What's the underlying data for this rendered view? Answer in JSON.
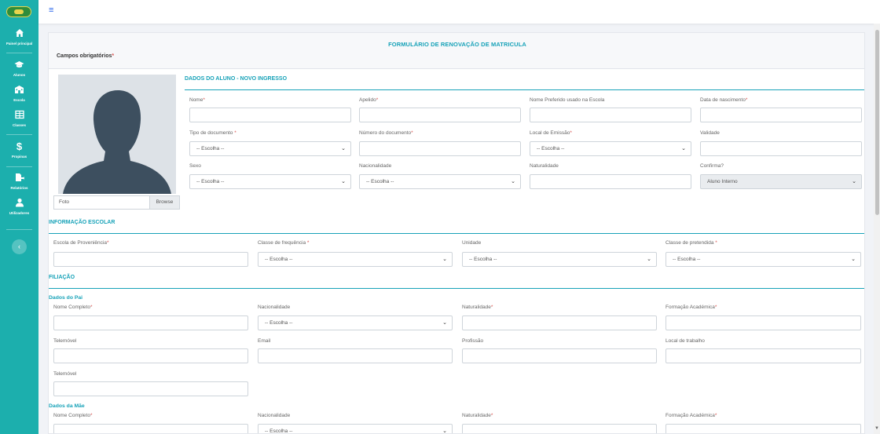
{
  "sidebar": {
    "items": [
      {
        "label": "Painel principal",
        "icon": "home-icon"
      },
      {
        "label": "Alunos",
        "icon": "graduation-cap-icon"
      },
      {
        "label": "Escola",
        "icon": "school-icon"
      },
      {
        "label": "Classes",
        "icon": "table-icon"
      },
      {
        "label": "Propinas",
        "icon": "dollar-icon"
      },
      {
        "label": "Relatórios",
        "icon": "report-icon"
      },
      {
        "label": "Utilizadores",
        "icon": "user-icon"
      }
    ],
    "collapse_glyph": "‹"
  },
  "topbar": {
    "menu_glyph": "≡"
  },
  "form": {
    "title": "FORMULÁRIO DE RENOVAÇÃO DE MATRICULA",
    "required_note": "Campos obrigatórios",
    "photo": {
      "placeholder": "Foto",
      "browse": "Browse"
    },
    "student": {
      "title": "DADOS DO ALUNO - NOVO INGRESSO",
      "nome": "Nome",
      "apelido": "Apelido",
      "nome_preferido": "Nome Preferido usado na Escola",
      "data_nascimento": "Data de nascimento",
      "tipo_documento": "Tipo de documento",
      "tipo_documento_value": "-- Escolha --",
      "numero_documento": "Número do documento",
      "local_emissao": "Local de Emissão",
      "local_emissao_value": "-- Escolha --",
      "validade": "Validade",
      "sexo": "Sexo",
      "sexo_value": "-- Escolha --",
      "nacionalidade": "Nacionalidade",
      "nacionalidade_value": "-- Escolha --",
      "naturalidade": "Naturalidade",
      "confirma": "Confirma?",
      "confirma_value": "Aluno Interno"
    },
    "school": {
      "title": "INFORMAÇÃO ESCOLAR",
      "escola_proveniencia": "Escola de Proveniência",
      "classe_frequencia": "Classe de frequência",
      "classe_frequencia_value": "-- Escolha --",
      "unidade": "Unidade",
      "unidade_value": "-- Escolha --",
      "classe_pretendida": "Classe de pretendida",
      "classe_pretendida_value": "-- Escolha --"
    },
    "filiacao": {
      "title": "FILIAÇÃO",
      "pai": {
        "title": "Dados do Pai",
        "nome": "Nome Completo",
        "nacionalidade": "Nacionalidade",
        "nacionalidade_value": "-- Escolha --",
        "naturalidade": "Naturalidade",
        "formacao": "Formação Académica",
        "telemovel": "Telemóvel",
        "email": "Email",
        "profissao": "Profissão",
        "local_trabalho": "Local de trabalho",
        "telemovel2": "Telemóvel"
      },
      "mae": {
        "title": "Dados da Mãe",
        "nome": "Nome Completo",
        "nacionalidade": "Nacionalidade",
        "nacionalidade_value": "-- Escolha --",
        "naturalidade": "Naturalidade",
        "formacao": "Formação Académica"
      }
    }
  }
}
